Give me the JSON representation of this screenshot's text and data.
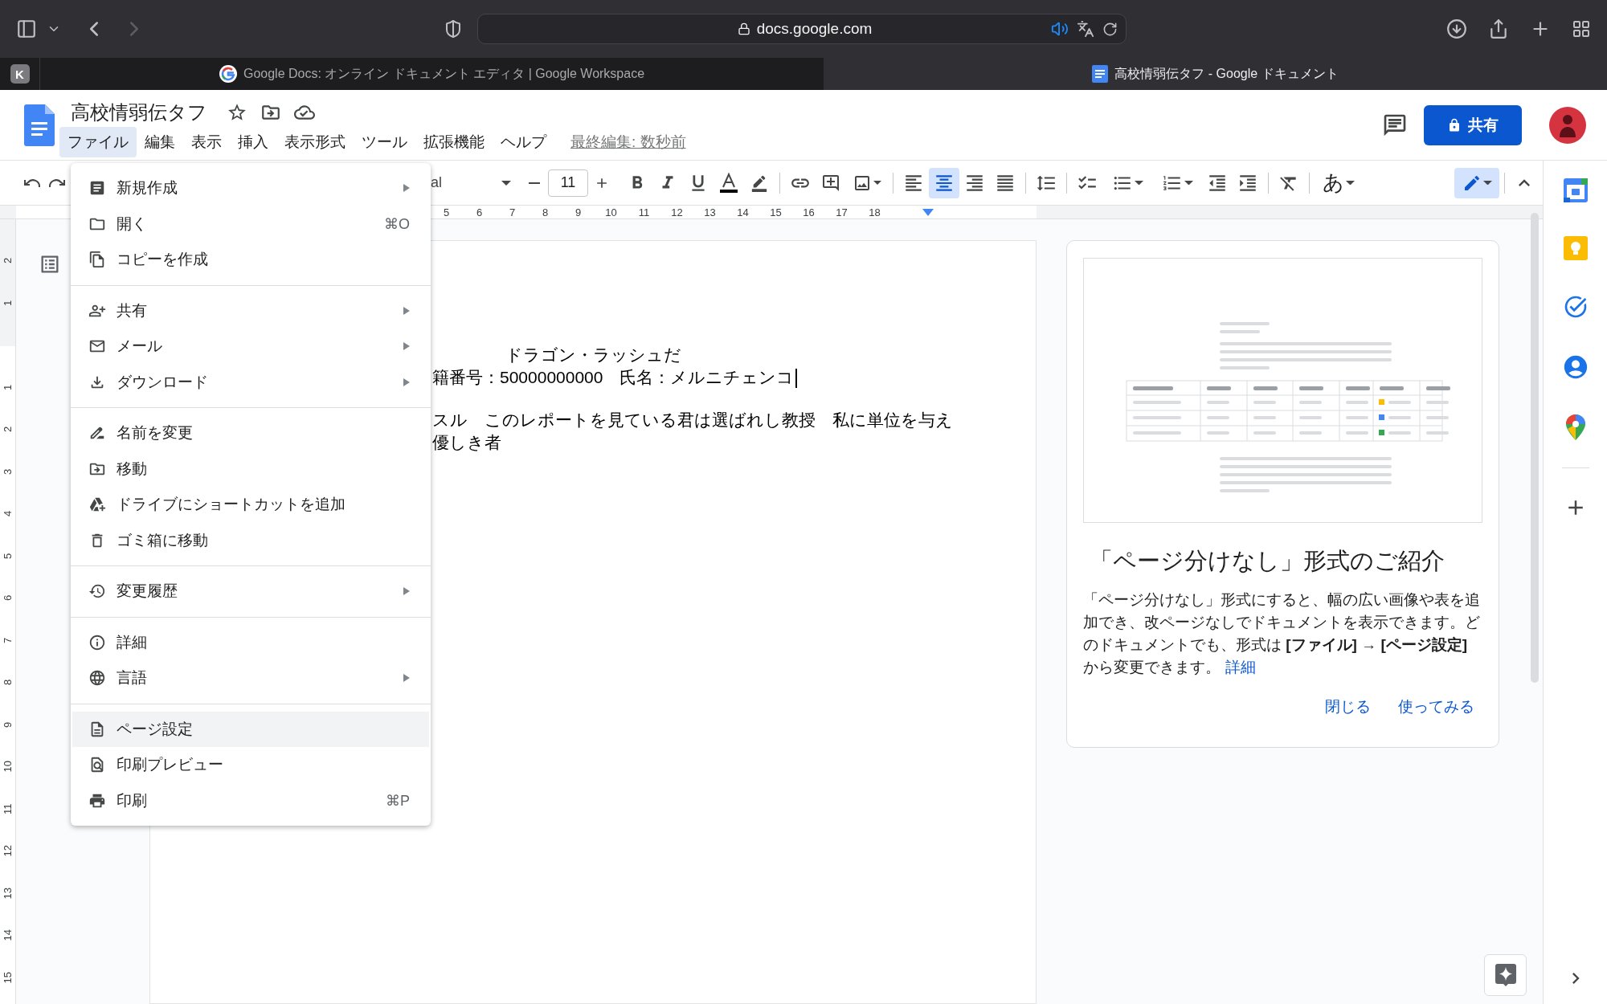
{
  "browser": {
    "url": "docs.google.com",
    "pinned_tab": "K",
    "tabs": [
      {
        "title": "Google Docs: オンライン ドキュメント エディタ | Google Workspace",
        "kind": "google",
        "selected": false
      },
      {
        "title": "高校情弱伝タフ - Google ドキュメント",
        "kind": "docs",
        "selected": true
      }
    ]
  },
  "document_title": "高校情弱伝タフ",
  "menu_bar": {
    "items": [
      {
        "label": "ファイル",
        "selected": true
      },
      {
        "label": "編集",
        "selected": false
      },
      {
        "label": "表示",
        "selected": false
      },
      {
        "label": "挿入",
        "selected": false
      },
      {
        "label": "表示形式",
        "selected": false
      },
      {
        "label": "ツール",
        "selected": false
      },
      {
        "label": "拡張機能",
        "selected": false
      },
      {
        "label": "ヘルプ",
        "selected": false
      }
    ],
    "last_edit": "最終編集: 数秒前"
  },
  "share_button": "共有",
  "toolbar": {
    "font": "al",
    "font_size": "11",
    "alignment": [
      {
        "selected": false
      },
      {
        "selected": true
      },
      {
        "selected": false
      },
      {
        "selected": false
      }
    ],
    "input_tool": "あ"
  },
  "ruler": [
    "5",
    "6",
    "7",
    "8",
    "9",
    "10",
    "11",
    "12",
    "13",
    "14",
    "15",
    "16",
    "17",
    "18"
  ],
  "vertical_ruler": {
    "above": [
      "2",
      "1"
    ],
    "below": [
      "1",
      "2",
      "3",
      "4",
      "5",
      "6",
      "7",
      "8",
      "9",
      "10",
      "11",
      "12",
      "13",
      "14",
      "15"
    ]
  },
  "document": {
    "lines": [
      {
        "text": "ドラゴン・ラッシュだ",
        "kind": "centered",
        "cursor": false
      },
      {
        "text": "籍番号：50000000000　氏名：メルニチェンコ",
        "kind": "plain",
        "cursor": true
      },
      {
        "text": "スル　このレポートを見ている君は選ばれし教授　私に単位を与え",
        "kind": "new_paragraph",
        "cursor": false
      },
      {
        "text": "優しき者",
        "kind": "plain",
        "cursor": false
      }
    ]
  },
  "file_menu": {
    "groups": [
      {
        "items": [
          {
            "label": "新規作成",
            "submenu": true,
            "highlighted": false
          },
          {
            "label": "開く",
            "shortcut": "⌘O",
            "submenu": false,
            "highlighted": false
          },
          {
            "label": "コピーを作成",
            "submenu": false,
            "highlighted": false
          }
        ]
      },
      {
        "items": [
          {
            "label": "共有",
            "submenu": true,
            "highlighted": false
          },
          {
            "label": "メール",
            "submenu": true,
            "highlighted": false
          },
          {
            "label": "ダウンロード",
            "submenu": true,
            "highlighted": false
          }
        ]
      },
      {
        "items": [
          {
            "label": "名前を変更",
            "submenu": false,
            "highlighted": false
          },
          {
            "label": "移動",
            "submenu": false,
            "highlighted": false
          },
          {
            "label": "ドライブにショートカットを追加",
            "submenu": false,
            "highlighted": false
          },
          {
            "label": "ゴミ箱に移動",
            "submenu": false,
            "highlighted": false
          }
        ]
      },
      {
        "items": [
          {
            "label": "変更履歴",
            "submenu": true,
            "highlighted": false
          }
        ]
      },
      {
        "items": [
          {
            "label": "詳細",
            "submenu": false,
            "highlighted": false
          },
          {
            "label": "言語",
            "submenu": true,
            "highlighted": false
          }
        ]
      },
      {
        "items": [
          {
            "label": "ページ設定",
            "submenu": false,
            "highlighted": true
          },
          {
            "label": "印刷プレビュー",
            "submenu": false,
            "highlighted": false
          },
          {
            "label": "印刷",
            "shortcut": "⌘P",
            "submenu": false,
            "highlighted": false
          }
        ]
      }
    ]
  },
  "side_card": {
    "title": "「ページ分けなし」形式のご紹介",
    "body": "「ページ分けなし」形式にすると、幅の広い画像や表を追加でき、改ページなしでドキュメントを表示できます。どのドキュメントでも、形式は **[ファイル]** → **[ページ設定]** から変更できます。",
    "link": "詳細",
    "buttons": [
      "閉じる",
      "使ってみる"
    ]
  }
}
